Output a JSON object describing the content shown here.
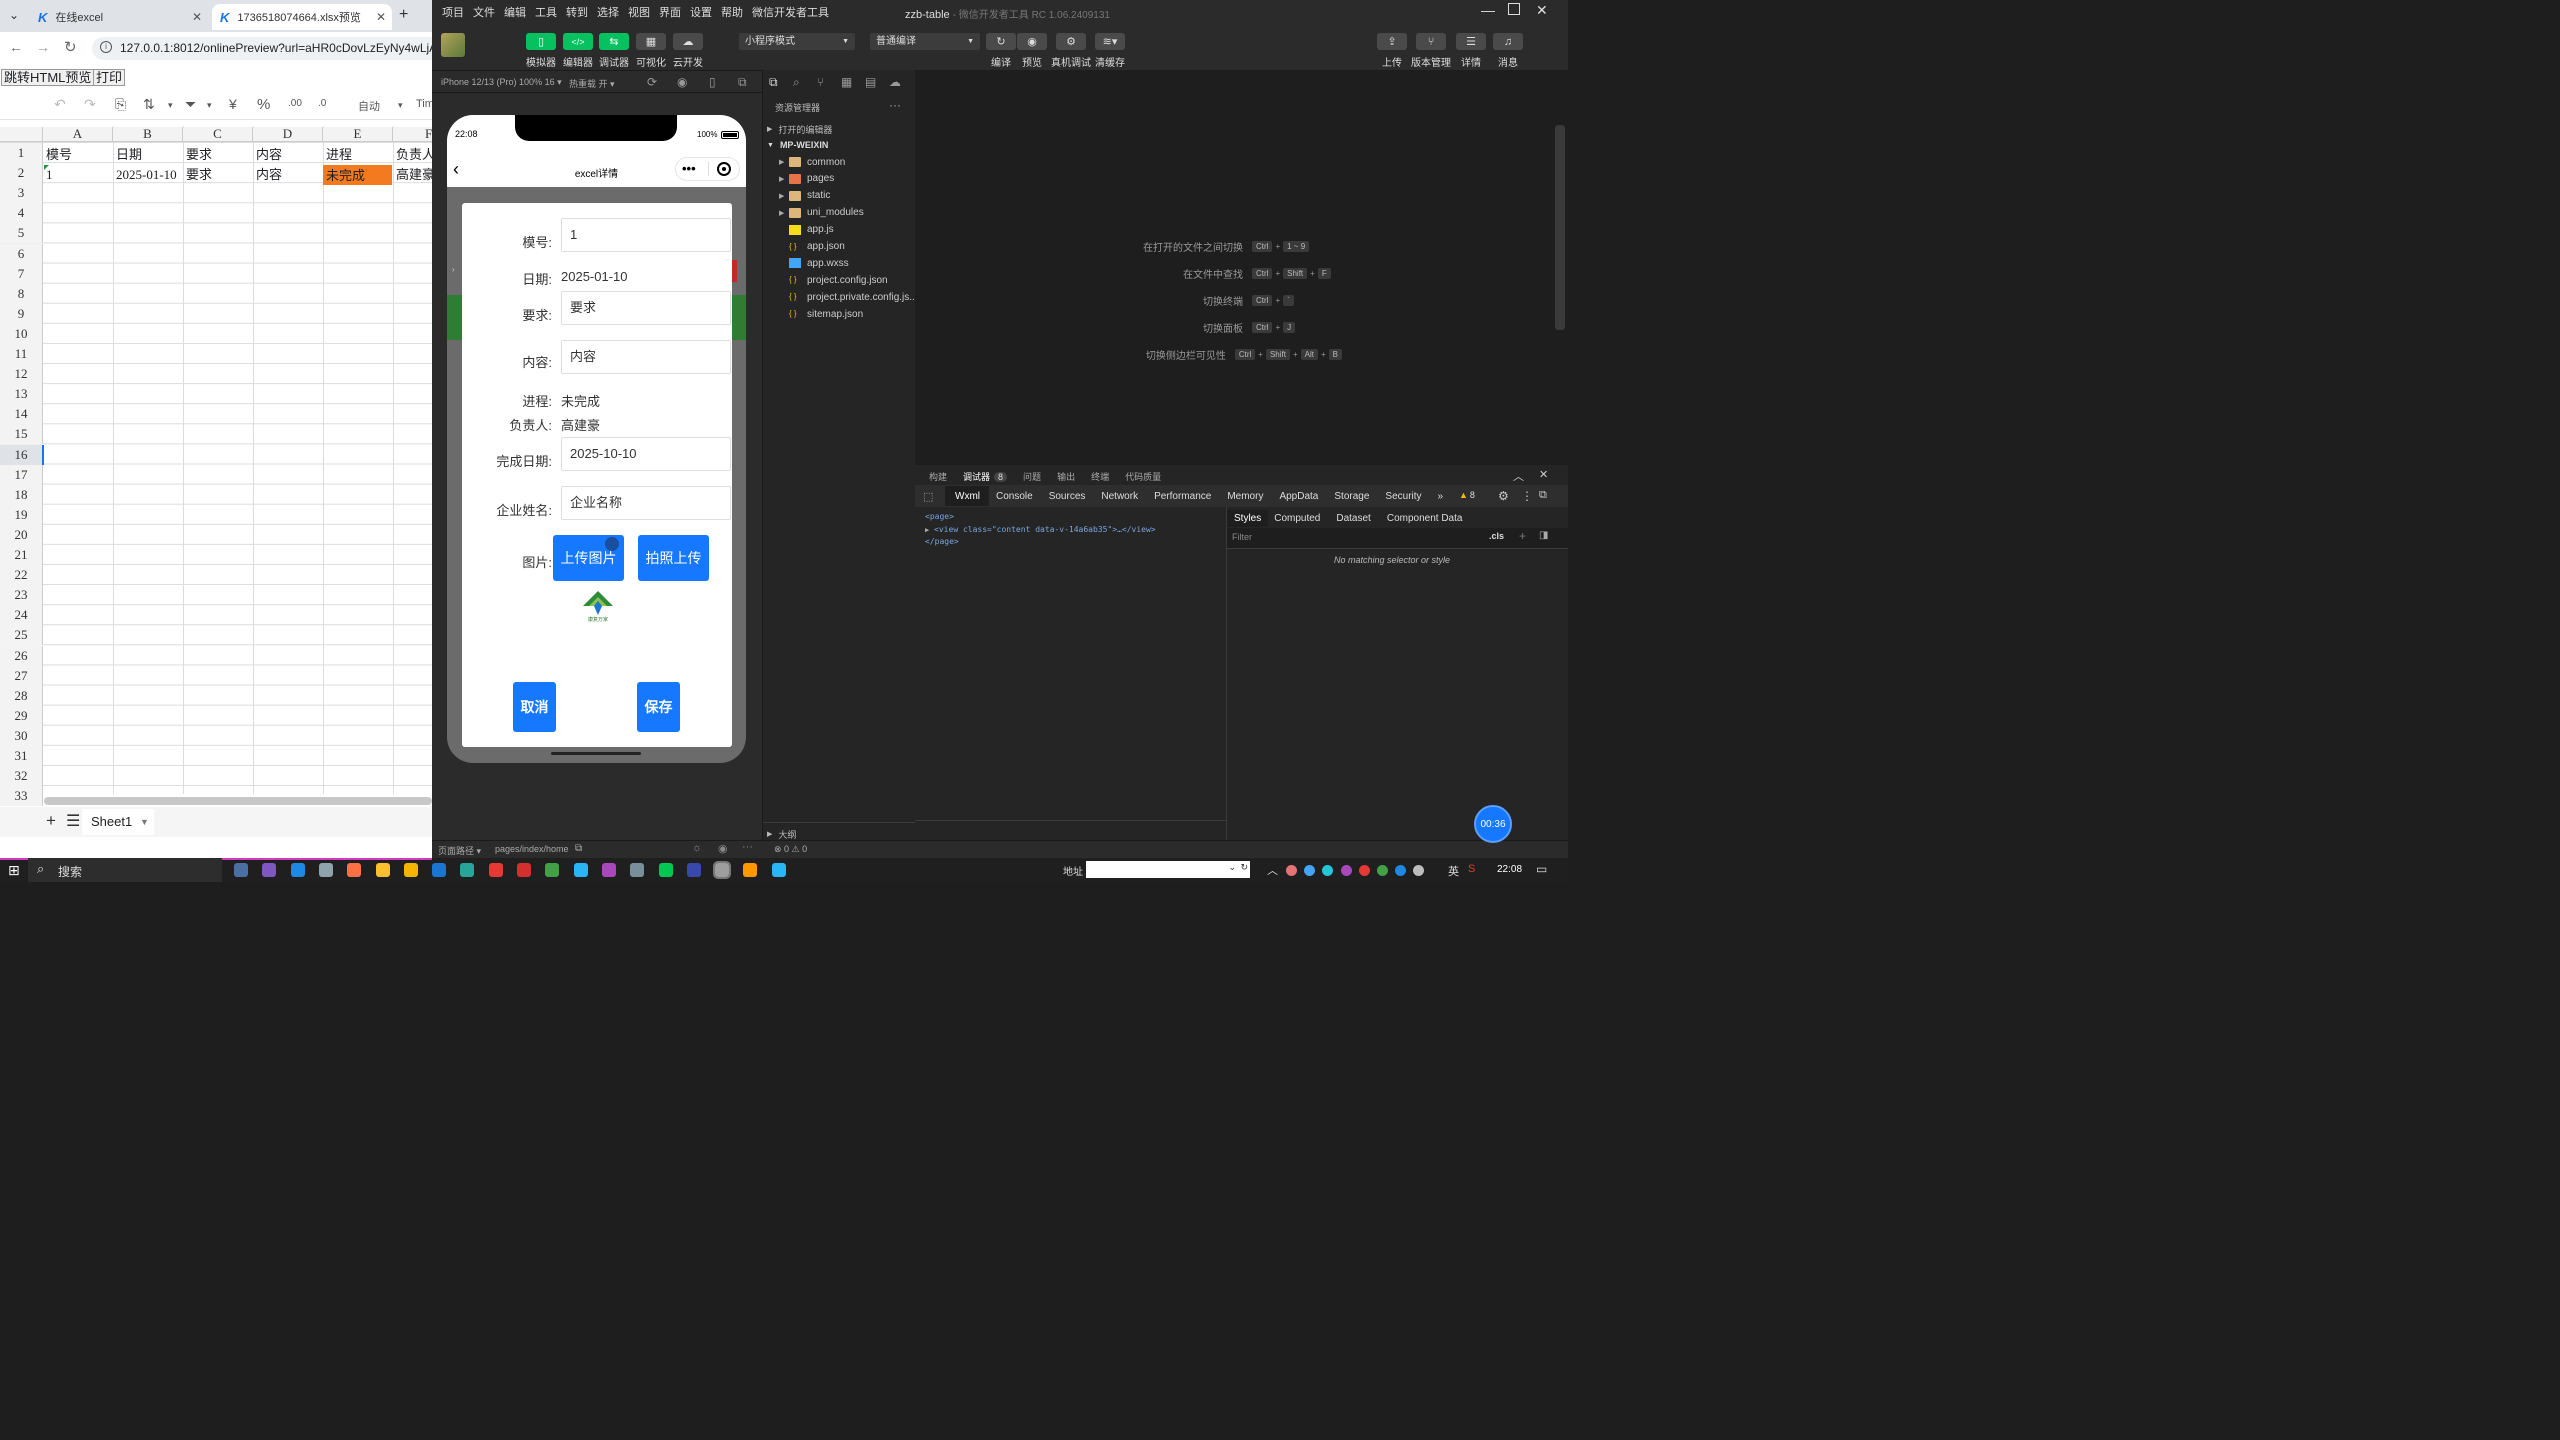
{
  "browser": {
    "tabs": [
      {
        "label": "在线excel"
      },
      {
        "label": "1736518074664.xlsx预览"
      }
    ],
    "url": "127.0.0.1:8012/onlinePreview?url=aHR0cDovLzEyNy4wLjAuM",
    "top_buttons": {
      "html_preview": "跳转HTML预览",
      "print": "打印"
    },
    "toolbar": {
      "font_size": "自动",
      "font_name": "Tim",
      "currency": "¥",
      "percent": "%"
    },
    "sheet": {
      "columns": [
        "A",
        "B",
        "C",
        "D",
        "E",
        "F"
      ],
      "row_numbers": [
        "1",
        "2",
        "3",
        "4",
        "5",
        "6",
        "7",
        "8",
        "9",
        "10",
        "11",
        "12",
        "13",
        "14",
        "15",
        "16",
        "17",
        "18",
        "19",
        "20",
        "21",
        "22",
        "23",
        "24",
        "25",
        "26",
        "27",
        "28",
        "29",
        "30",
        "31",
        "32",
        "33"
      ],
      "rows": [
        [
          "模号",
          "日期",
          "要求",
          "内容",
          "进程",
          "负责人"
        ],
        [
          "1",
          "2025-01-10",
          "要求",
          "内容",
          "未完成",
          "高建豪"
        ]
      ],
      "highlight_color": "#f47a1f",
      "sheet_tab": "Sheet1"
    }
  },
  "ide": {
    "menu": [
      "项目",
      "文件",
      "编辑",
      "工具",
      "转到",
      "选择",
      "视图",
      "界面",
      "设置",
      "帮助",
      "微信开发者工具"
    ],
    "title": "zzb-table",
    "subtitle": "- 微信开发者工具 RC 1.06.2409131",
    "toolbar_left": [
      "模拟器",
      "编辑器",
      "调试器",
      "可视化",
      "云开发"
    ],
    "mode_select": "小程序模式",
    "compile_select": "普通编译",
    "toolbar_mid": [
      "编译",
      "预览",
      "真机调试",
      "清缓存"
    ],
    "toolbar_right": [
      "上传",
      "版本管理",
      "详情",
      "消息"
    ],
    "device_info": "iPhone 12/13 (Pro) 100% 16 ▾",
    "hot_reload": "热重载 开 ▾",
    "explorer": {
      "title": "资源管理器",
      "open_editors": "打开的编辑器",
      "project": "MP-WEIXIN",
      "items": [
        {
          "name": "common",
          "type": "folder"
        },
        {
          "name": "pages",
          "type": "folder"
        },
        {
          "name": "static",
          "type": "folder"
        },
        {
          "name": "uni_modules",
          "type": "folder"
        },
        {
          "name": "app.js",
          "type": "js"
        },
        {
          "name": "app.json",
          "type": "json"
        },
        {
          "name": "app.wxss",
          "type": "wxss"
        },
        {
          "name": "project.config.json",
          "type": "json"
        },
        {
          "name": "project.private.config.js...",
          "type": "json"
        },
        {
          "name": "sitemap.json",
          "type": "json"
        }
      ],
      "outline": "大纲"
    },
    "shortcuts": [
      {
        "label": "在打开的文件之间切换",
        "keys": [
          "Ctrl",
          "1 ~ 9"
        ]
      },
      {
        "label": "在文件中查找",
        "keys": [
          "Ctrl",
          "Shift",
          "F"
        ]
      },
      {
        "label": "切换终端",
        "keys": [
          "Ctrl",
          "`"
        ]
      },
      {
        "label": "切换面板",
        "keys": [
          "Ctrl",
          "J"
        ]
      },
      {
        "label": "切换侧边栏可见性",
        "keys": [
          "Ctrl",
          "Shift",
          "Alt",
          "B"
        ]
      }
    ],
    "panel_tabs": [
      "构建",
      "调试器",
      "问题",
      "输出",
      "终端",
      "代码质量"
    ],
    "debugger_badge": "8",
    "devtools_tabs": [
      "Wxml",
      "Console",
      "Sources",
      "Network",
      "Performance",
      "Memory",
      "AppData",
      "Storage",
      "Security"
    ],
    "warning_count": "8",
    "wxml": {
      "line1": "<page>",
      "line2": "<view class=\"content data-v-14a6ab35\">…</view>",
      "line3": "</page>"
    },
    "styles_tabs": [
      "Styles",
      "Computed",
      "Dataset",
      "Component Data"
    ],
    "filter_placeholder": "Filter",
    "cls": ".cls",
    "no_match": "No matching selector or style",
    "status_path_label": "页面路径 ▾",
    "status_path": "pages/index/home",
    "status_errors": "⊗ 0 ⚠ 0",
    "timer": "00:36"
  },
  "phone": {
    "time": "22:08",
    "battery": "100%",
    "nav_title": "excel详情",
    "form": {
      "mold_label": "模号:",
      "mold_value": "1",
      "date_label": "日期:",
      "date_value": "2025-01-10",
      "req_label": "要求:",
      "req_value": "要求",
      "content_label": "内容:",
      "content_value": "内容",
      "progress_label": "进程:",
      "progress_value": "未完成",
      "owner_label": "负责人:",
      "owner_value": "高建豪",
      "done_label": "完成日期:",
      "done_value": "2025-10-10",
      "company_label": "企业姓名:",
      "company_placeholder": "企业名称",
      "image_label": "图片:",
      "upload_btn": "上传图片",
      "camera_btn": "拍照上传",
      "logo_text": "康复万家",
      "cancel_btn": "取消",
      "save_btn": "保存"
    }
  },
  "taskbar": {
    "search": "搜索",
    "address_label": "地址",
    "ime": "英",
    "clock": "22:08"
  }
}
